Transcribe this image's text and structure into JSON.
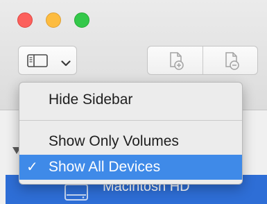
{
  "window": {
    "titlebar": {
      "traffic_lights": [
        "close",
        "minimize",
        "zoom"
      ],
      "toolbar": {
        "sidebar_button": {
          "icon": "sidebar-icon",
          "dropdown_icon": "chevron-down-icon"
        },
        "add_volume_button": {
          "icon": "add-volume-icon"
        },
        "remove_volume_button": {
          "icon": "remove-volume-icon"
        }
      }
    },
    "sidebar": {
      "selected_item": {
        "label": "Macintosh HD",
        "icon": "hard-disk-icon"
      }
    }
  },
  "view_menu": {
    "items": [
      {
        "label": "Hide Sidebar",
        "checked": false,
        "highlighted": false
      },
      {
        "label": "Show Only Volumes",
        "checked": false,
        "highlighted": false
      },
      {
        "label": "Show All Devices",
        "checked": true,
        "highlighted": true
      }
    ],
    "check_mark": "✓"
  },
  "colors": {
    "highlight": "#3f8ae8",
    "selection": "#2e6ed6",
    "close": "#fc605c",
    "minimize": "#fdbc40",
    "zoom": "#34c84a"
  }
}
